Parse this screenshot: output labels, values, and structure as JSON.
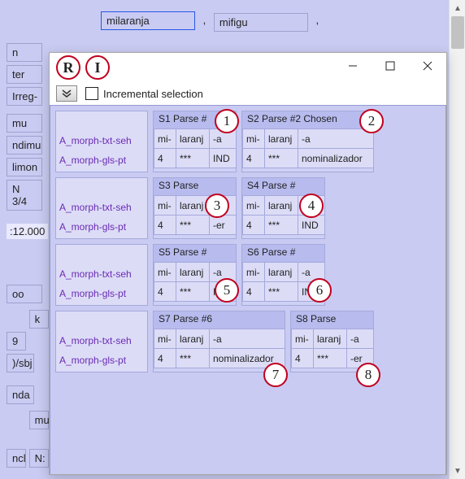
{
  "bg": {
    "input1": "milaranja",
    "input2": "mifigu",
    "left_rows": [
      "n",
      "ter",
      "Irreg-",
      "mu",
      "ndimu",
      "limon",
      "N 3/4"
    ],
    "time_label": ":12.000",
    "foot1": "oo",
    "foot_k": "k",
    "foot_9": "9",
    "foot_sbj": ")/sbj",
    "foot_nda": "nda",
    "foot_mu": "mu",
    "foot_ncl": "ncl",
    "foot_N": "N:"
  },
  "dialog": {
    "title_letters": [
      "R",
      "I"
    ],
    "toolbar": {
      "incremental_label": "Incremental selection"
    },
    "left_labels": [
      "A_morph-txt-seh",
      "A_morph-gls-pt"
    ],
    "parses": [
      {
        "head": "S1 Parse #",
        "txt": [
          "mi-",
          "laranj",
          "-a"
        ],
        "gls": [
          "4",
          "***",
          "IND"
        ]
      },
      {
        "head": "S2 Parse #2 Chosen",
        "txt": [
          "mi-",
          "laranj",
          "-a"
        ],
        "gls": [
          "4",
          "***",
          "nominalizador"
        ]
      },
      {
        "head": "S3 Parse",
        "txt": [
          "mi-",
          "laranj",
          "-a"
        ],
        "gls": [
          "4",
          "***",
          "-er"
        ]
      },
      {
        "head": "S4 Parse #",
        "txt": [
          "mi-",
          "laranj",
          "-a"
        ],
        "gls": [
          "4",
          "***",
          "IND"
        ]
      },
      {
        "head": "S5 Parse #",
        "txt": [
          "mi-",
          "laranj",
          "-a"
        ],
        "gls": [
          "4",
          "***",
          "IND"
        ]
      },
      {
        "head": "S6 Parse #",
        "txt": [
          "mi-",
          "laranj",
          "-a"
        ],
        "gls": [
          "4",
          "***",
          "IND"
        ]
      },
      {
        "head": "S7 Parse #6",
        "txt": [
          "mi-",
          "laranj",
          "-a"
        ],
        "gls": [
          "4",
          "***",
          "nominalizador"
        ]
      },
      {
        "head": "S8 Parse",
        "txt": [
          "mi-",
          "laranj",
          "-a"
        ],
        "gls": [
          "4",
          "***",
          "-er"
        ]
      }
    ],
    "circle_numbers": [
      "1",
      "2",
      "3",
      "4",
      "5",
      "6",
      "7",
      "8"
    ]
  }
}
